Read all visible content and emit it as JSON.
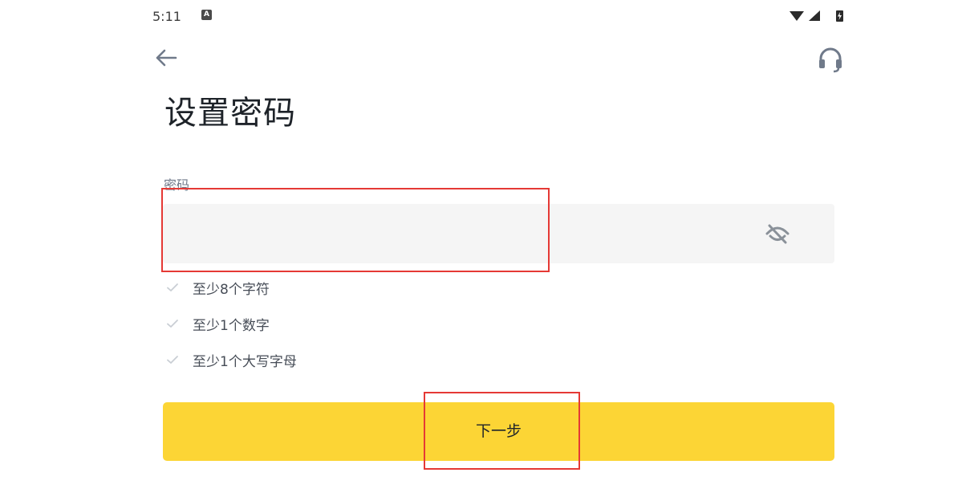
{
  "status_bar": {
    "time": "5:11",
    "notification_badge": "A",
    "icons": [
      "wifi-icon",
      "signal-icon",
      "battery-charging-icon"
    ]
  },
  "header": {
    "back_icon": "arrow-left-icon",
    "support_icon": "headset-icon"
  },
  "page": {
    "title": "设置密码"
  },
  "password_field": {
    "label": "密码",
    "value": "",
    "placeholder": "",
    "visibility_icon": "eye-off-icon"
  },
  "requirements": [
    {
      "text": "至少8个字符",
      "met": false
    },
    {
      "text": "至少1个数字",
      "met": false
    },
    {
      "text": "至少1个大写字母",
      "met": false
    }
  ],
  "next_button": {
    "label": "下一步"
  },
  "colors": {
    "accent": "#fcd535",
    "input_bg": "#f5f5f5",
    "annotation": "#e53935",
    "muted_text": "#707a8a"
  }
}
